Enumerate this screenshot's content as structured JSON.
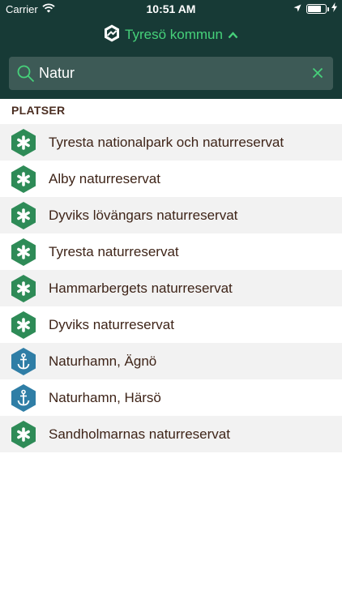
{
  "status_bar": {
    "carrier": "Carrier",
    "time": "10:51 AM",
    "battery_level": 0.75
  },
  "header": {
    "municipality": "Tyresö kommun"
  },
  "search": {
    "value": "Natur",
    "placeholder": ""
  },
  "section": {
    "title": "PLATSER"
  },
  "colors": {
    "header_bg": "#173a36",
    "accent": "#46d17a",
    "nature": "#2e8b57",
    "harbor": "#2f7ea6"
  },
  "places": [
    {
      "label": "Tyresta nationalpark och naturreservat",
      "icon": "nature-reserve-icon"
    },
    {
      "label": "Alby naturreservat",
      "icon": "nature-reserve-icon"
    },
    {
      "label": "Dyviks lövängars naturreservat",
      "icon": "nature-reserve-icon"
    },
    {
      "label": "Tyresta naturreservat",
      "icon": "nature-reserve-icon"
    },
    {
      "label": "Hammarbergets naturreservat",
      "icon": "nature-reserve-icon"
    },
    {
      "label": "Dyviks naturreservat",
      "icon": "nature-reserve-icon"
    },
    {
      "label": "Naturhamn, Ägnö",
      "icon": "anchor-icon"
    },
    {
      "label": "Naturhamn, Härsö",
      "icon": "anchor-icon"
    },
    {
      "label": "Sandholmarnas naturreservat",
      "icon": "nature-reserve-icon"
    }
  ]
}
